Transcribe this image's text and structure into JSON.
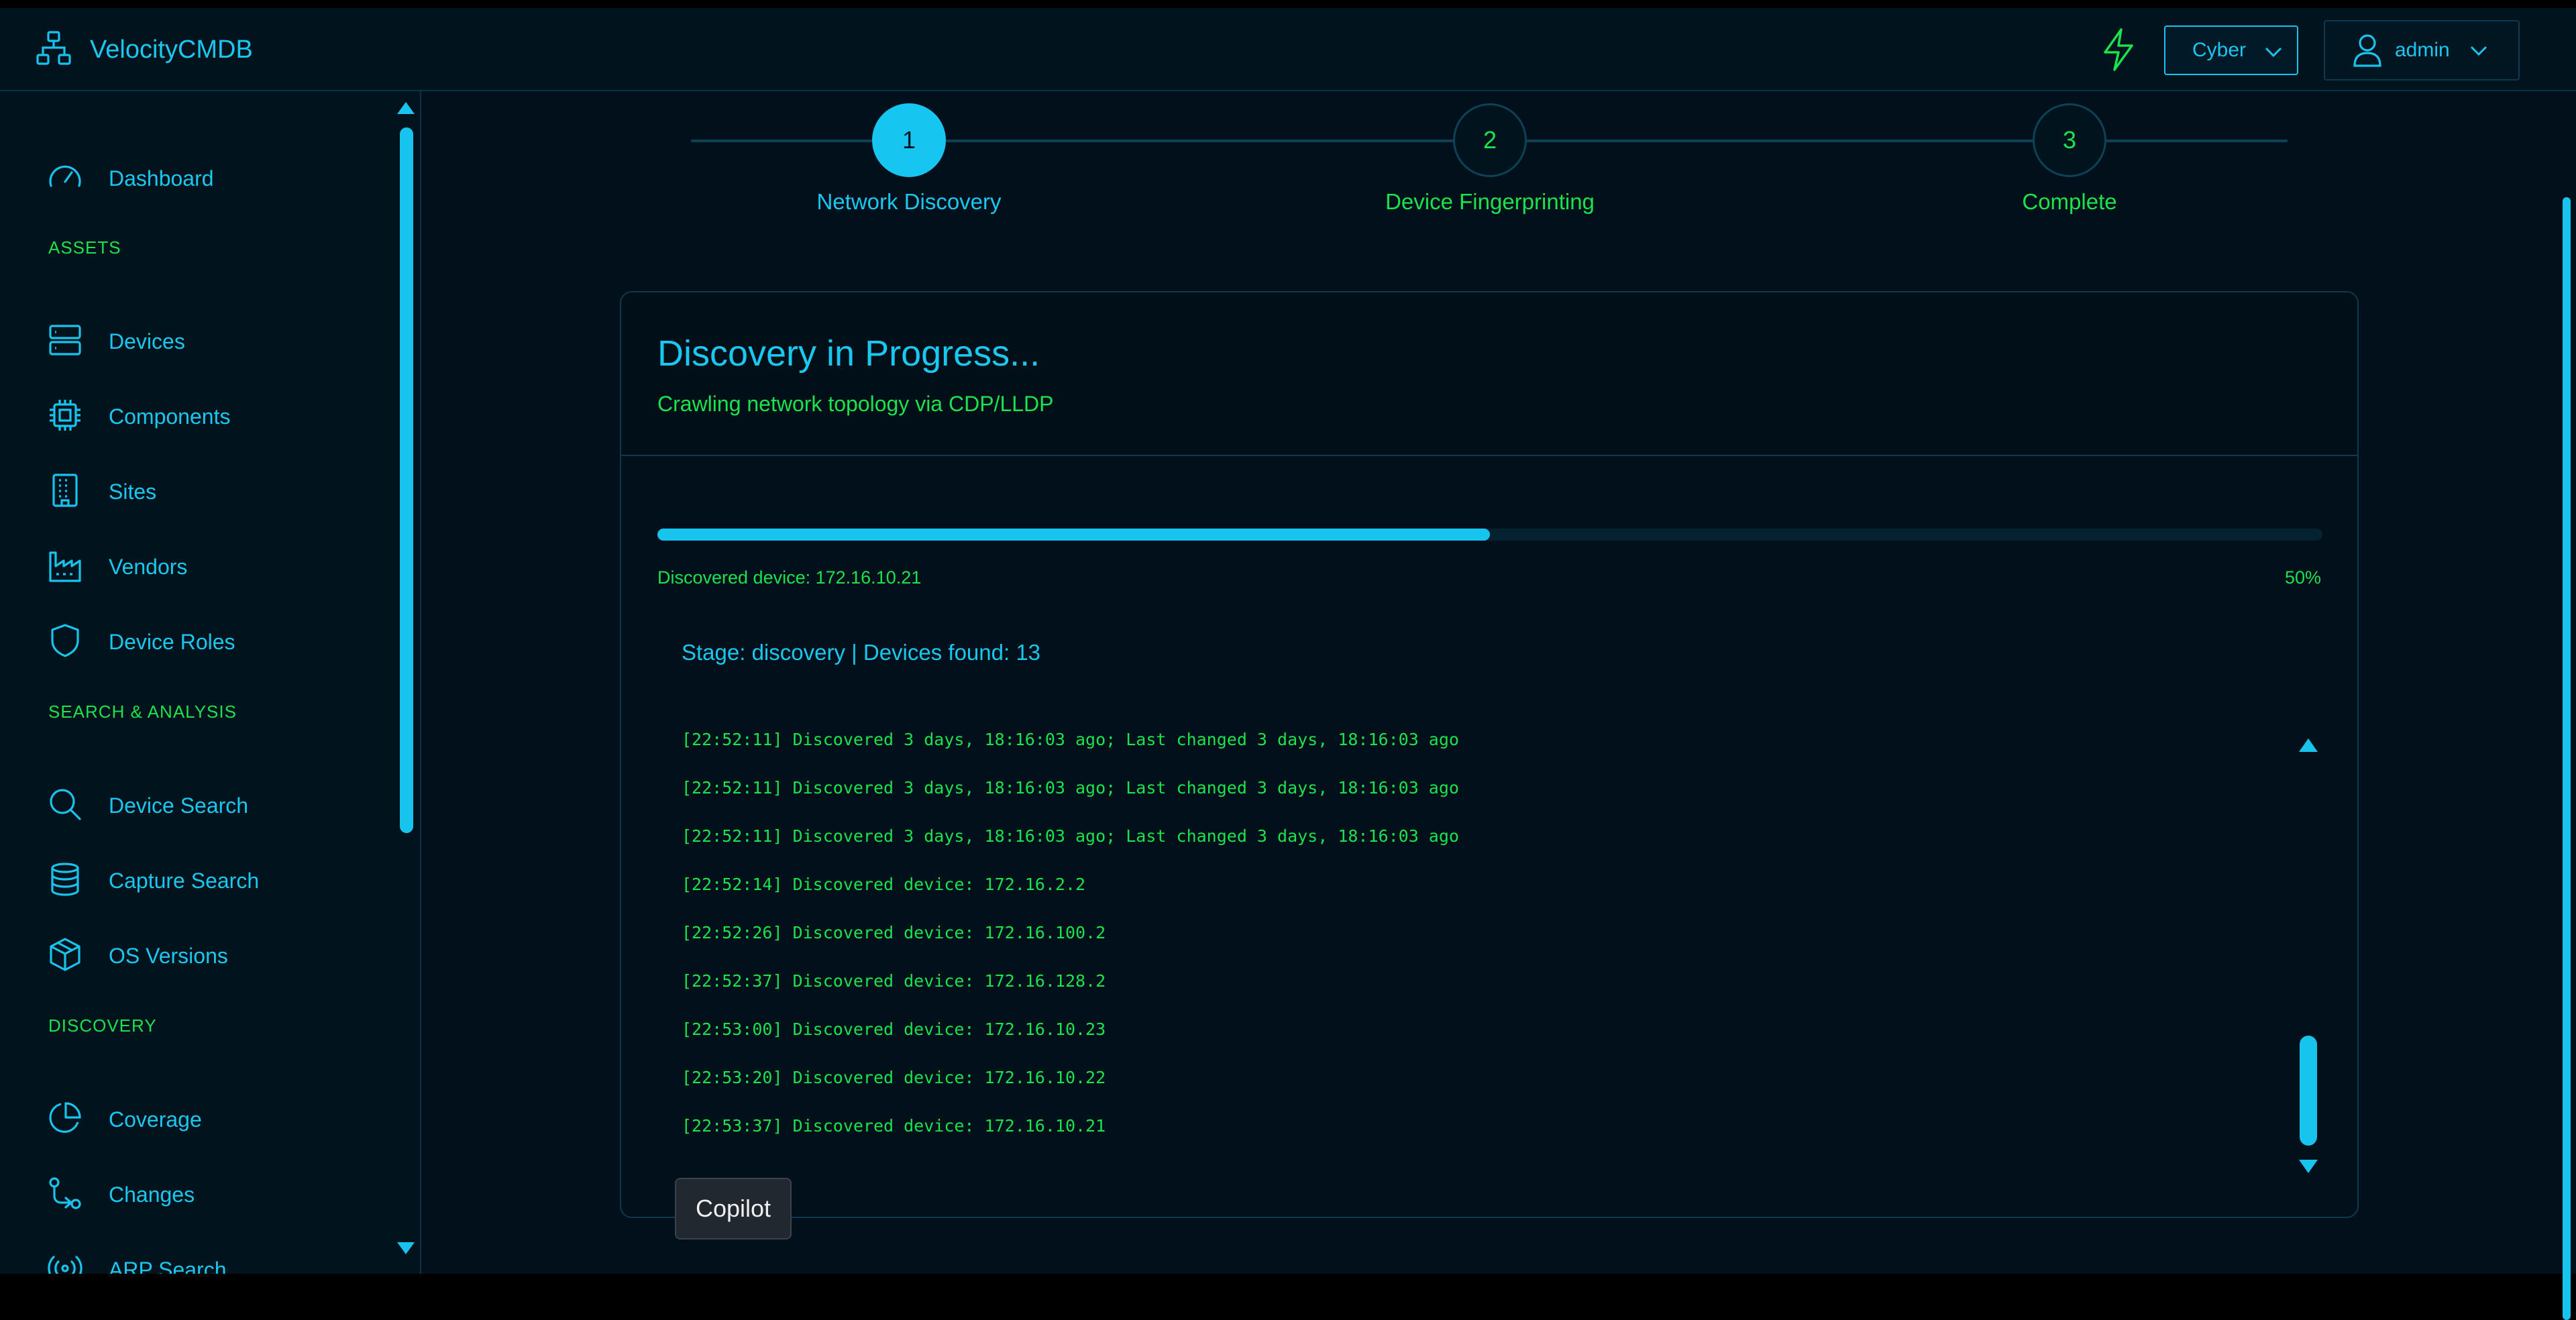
{
  "app": {
    "brand": "VelocityCMDB",
    "theme_value": "Cyber",
    "user_name": "admin"
  },
  "colors": {
    "accent": "#17c4ee",
    "success_text": "#19e34d",
    "background": "#01101a"
  },
  "icons": {
    "brand": "network-icon",
    "bolt": "lightning-icon",
    "user": "user-icon"
  },
  "sidebar": {
    "top_items": [
      {
        "label": "Dashboard",
        "icon": "gauge-icon"
      }
    ],
    "sections": [
      {
        "title": "ASSETS",
        "items": [
          {
            "label": "Devices",
            "icon": "server-icon"
          },
          {
            "label": "Components",
            "icon": "chip-icon"
          },
          {
            "label": "Sites",
            "icon": "building-icon"
          },
          {
            "label": "Vendors",
            "icon": "factory-icon"
          },
          {
            "label": "Device Roles",
            "icon": "shield-icon"
          }
        ]
      },
      {
        "title": "SEARCH & ANALYSIS",
        "items": [
          {
            "label": "Device Search",
            "icon": "search-icon"
          },
          {
            "label": "Capture Search",
            "icon": "database-icon"
          },
          {
            "label": "OS Versions",
            "icon": "package-icon"
          }
        ]
      },
      {
        "title": "DISCOVERY",
        "items": [
          {
            "label": "Coverage",
            "icon": "pie-chart-icon"
          },
          {
            "label": "Changes",
            "icon": "git-compare-icon"
          },
          {
            "label": "ARP Search",
            "icon": "broadcast-icon"
          }
        ]
      }
    ]
  },
  "stepper": {
    "steps": [
      {
        "number": "1",
        "label": "Network Discovery",
        "active": true
      },
      {
        "number": "2",
        "label": "Device Fingerprinting",
        "active": false
      },
      {
        "number": "3",
        "label": "Complete",
        "active": false
      }
    ]
  },
  "discovery": {
    "title": "Discovery in Progress...",
    "subtitle": "Crawling network topology via CDP/LLDP",
    "progress_message": "Discovered device: 172.16.10.21",
    "progress_percent_label": "50%",
    "progress_fraction": 0.5,
    "stage_text": "Stage: discovery | Devices found: 13",
    "log_lines": [
      "[22:52:11] Discovered 3 days, 18:16:03 ago; Last changed 3 days, 18:16:03 ago",
      "[22:52:11] Discovered 3 days, 18:16:03 ago; Last changed 3 days, 18:16:03 ago",
      "[22:52:11] Discovered 3 days, 18:16:03 ago; Last changed 3 days, 18:16:03 ago",
      "[22:52:14] Discovered device: 172.16.2.2",
      "[22:52:26] Discovered device: 172.16.100.2",
      "[22:52:37] Discovered device: 172.16.128.2",
      "[22:53:00] Discovered device: 172.16.10.23",
      "[22:53:20] Discovered device: 172.16.10.22",
      "[22:53:37] Discovered device: 172.16.10.21"
    ]
  },
  "copilot": {
    "label": "Copilot"
  }
}
